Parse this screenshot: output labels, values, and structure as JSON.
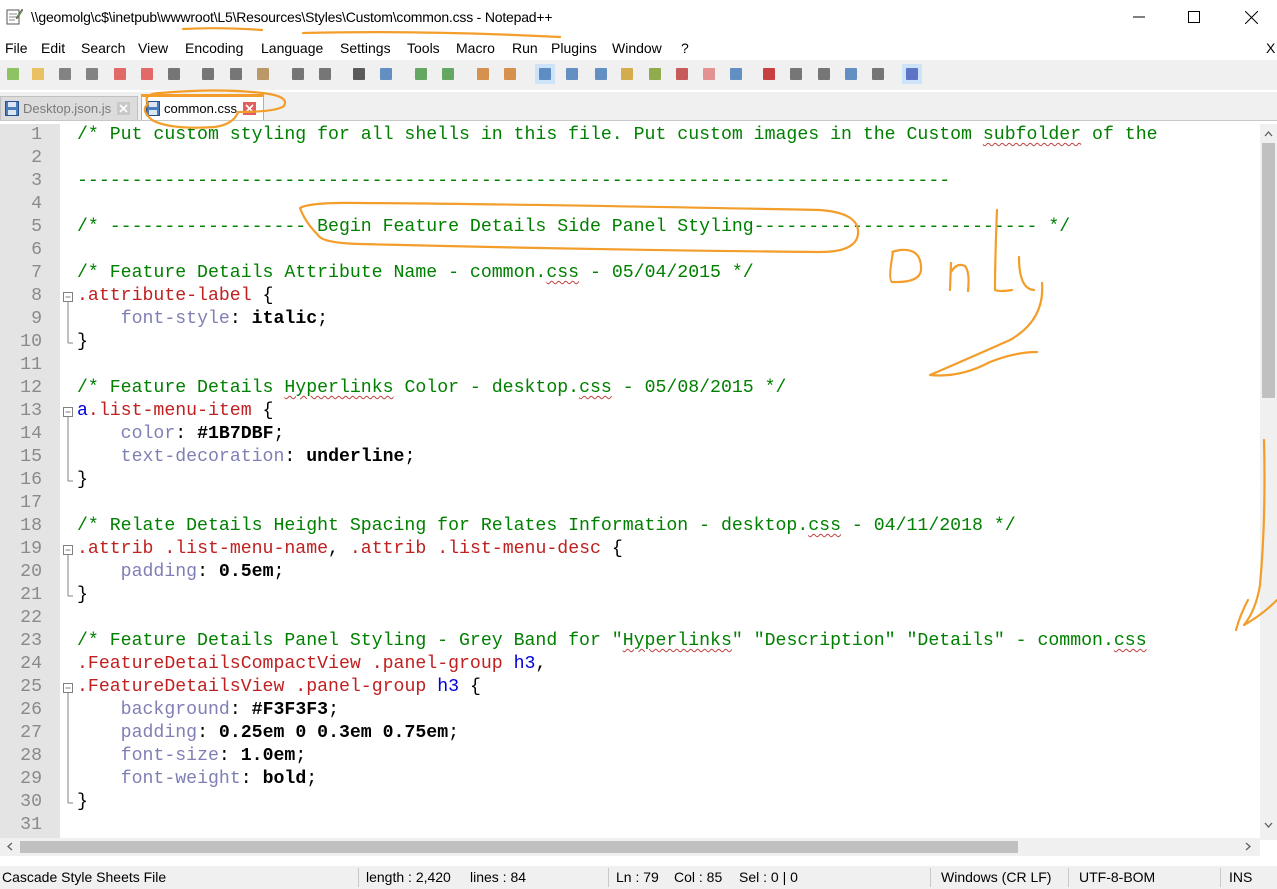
{
  "window": {
    "title": "\\\\geomolg\\c$\\inetpub\\wwwroot\\L5\\Resources\\Styles\\Custom\\common.css - Notepad++",
    "minimize_glyph": "—",
    "close_glyph": "✕"
  },
  "menu": {
    "items": [
      "File",
      "Edit",
      "Search",
      "View",
      "Encoding",
      "Language",
      "Settings",
      "Tools",
      "Macro",
      "Run",
      "Plugins",
      "Window",
      "?"
    ],
    "close_doc": "X"
  },
  "toolbar": {
    "icons": [
      "new-file-icon",
      "open-file-icon",
      "save-icon",
      "save-all-icon",
      "close-icon",
      "close-all-icon",
      "print-icon",
      "cut-icon",
      "copy-icon",
      "paste-icon",
      "undo-icon",
      "redo-icon",
      "find-icon",
      "replace-icon",
      "zoom-in-icon",
      "zoom-out-icon",
      "sync-vertical-icon",
      "sync-horizontal-icon",
      "word-wrap-icon",
      "show-all-chars-icon",
      "indent-guide-icon",
      "doc-map-icon",
      "function-list-icon",
      "folder-workspace-icon",
      "monitor-icon",
      "eye-icon",
      "record-macro-icon",
      "stop-macro-icon",
      "play-macro-icon",
      "run-macro-multiple-icon",
      "save-macro-icon",
      "spell-check-icon"
    ]
  },
  "tabs": [
    {
      "label": "Desktop.json.js",
      "active": false
    },
    {
      "label": "common.css",
      "active": true
    }
  ],
  "editor": {
    "lines": [
      {
        "n": "1",
        "segs": [
          {
            "t": "/* Put custom styling for all shells in this file. Put custom images in the Custom ",
            "c": "c"
          },
          {
            "t": "subfolder",
            "c": "c sq"
          },
          {
            "t": " of the",
            "c": "c"
          }
        ]
      },
      {
        "n": "2",
        "segs": []
      },
      {
        "n": "3",
        "segs": [
          {
            "t": "--------------------------------------------------------------------------------",
            "c": "c"
          }
        ]
      },
      {
        "n": "4",
        "segs": []
      },
      {
        "n": "5",
        "segs": [
          {
            "t": "/* ------------------ Begin Feature Details Side Panel Styling-------------------------- */",
            "c": "c"
          }
        ]
      },
      {
        "n": "6",
        "segs": []
      },
      {
        "n": "7",
        "segs": [
          {
            "t": "/* Feature Details Attribute Name - common.",
            "c": "c"
          },
          {
            "t": "css",
            "c": "c sq"
          },
          {
            "t": " - 05/04/2015 */",
            "c": "c"
          }
        ]
      },
      {
        "n": "8",
        "fold": "start",
        "segs": [
          {
            "t": ".attribute-label",
            "c": "s"
          },
          {
            "t": " {",
            "c": "o"
          }
        ]
      },
      {
        "n": "9",
        "fold": "mid",
        "segs": [
          {
            "t": "    ",
            "c": "o"
          },
          {
            "t": "font-style",
            "c": "p"
          },
          {
            "t": ": ",
            "c": "o"
          },
          {
            "t": "italic",
            "c": "v"
          },
          {
            "t": ";",
            "c": "o"
          }
        ]
      },
      {
        "n": "10",
        "fold": "end",
        "segs": [
          {
            "t": "}",
            "c": "o"
          }
        ]
      },
      {
        "n": "11",
        "segs": []
      },
      {
        "n": "12",
        "segs": [
          {
            "t": "/* Feature Details ",
            "c": "c"
          },
          {
            "t": "Hyperlinks",
            "c": "c sq"
          },
          {
            "t": " Color - desktop.",
            "c": "c"
          },
          {
            "t": "css",
            "c": "c sq"
          },
          {
            "t": " - 05/08/2015 */",
            "c": "c"
          }
        ]
      },
      {
        "n": "13",
        "fold": "start",
        "segs": [
          {
            "t": "a",
            "c": "k"
          },
          {
            "t": ".list-menu-item",
            "c": "s"
          },
          {
            "t": " {",
            "c": "o"
          }
        ]
      },
      {
        "n": "14",
        "fold": "mid",
        "segs": [
          {
            "t": "    ",
            "c": "o"
          },
          {
            "t": "color",
            "c": "p"
          },
          {
            "t": ": ",
            "c": "o"
          },
          {
            "t": "#1B7DBF",
            "c": "v"
          },
          {
            "t": ";",
            "c": "o"
          }
        ]
      },
      {
        "n": "15",
        "fold": "mid",
        "segs": [
          {
            "t": "    ",
            "c": "o"
          },
          {
            "t": "text-decoration",
            "c": "p"
          },
          {
            "t": ": ",
            "c": "o"
          },
          {
            "t": "underline",
            "c": "v"
          },
          {
            "t": ";",
            "c": "o"
          }
        ]
      },
      {
        "n": "16",
        "fold": "end",
        "segs": [
          {
            "t": "}",
            "c": "o"
          }
        ]
      },
      {
        "n": "17",
        "segs": []
      },
      {
        "n": "18",
        "segs": [
          {
            "t": "/* Relate Details Height Spacing for Relates Information - desktop.",
            "c": "c"
          },
          {
            "t": "css",
            "c": "c sq"
          },
          {
            "t": " - 04/11/2018 */",
            "c": "c"
          }
        ]
      },
      {
        "n": "19",
        "fold": "start",
        "segs": [
          {
            "t": ".attrib",
            "c": "s"
          },
          {
            "t": " ",
            "c": "o"
          },
          {
            "t": ".list-menu-name",
            "c": "s"
          },
          {
            "t": ", ",
            "c": "o"
          },
          {
            "t": ".attrib",
            "c": "s"
          },
          {
            "t": " ",
            "c": "o"
          },
          {
            "t": ".list-menu-desc",
            "c": "s"
          },
          {
            "t": " {",
            "c": "o"
          }
        ]
      },
      {
        "n": "20",
        "fold": "mid",
        "segs": [
          {
            "t": "    ",
            "c": "o"
          },
          {
            "t": "padding",
            "c": "p"
          },
          {
            "t": ": ",
            "c": "o"
          },
          {
            "t": "0.5em",
            "c": "v"
          },
          {
            "t": ";",
            "c": "o"
          }
        ]
      },
      {
        "n": "21",
        "fold": "end",
        "segs": [
          {
            "t": "}",
            "c": "o"
          }
        ]
      },
      {
        "n": "22",
        "segs": []
      },
      {
        "n": "23",
        "segs": [
          {
            "t": "/* Feature Details Panel Styling - Grey Band for \"",
            "c": "c"
          },
          {
            "t": "Hyperlinks",
            "c": "c sq"
          },
          {
            "t": "\" \"Description\" \"Details\" - common.",
            "c": "c"
          },
          {
            "t": "css",
            "c": "c sq"
          }
        ]
      },
      {
        "n": "24",
        "segs": [
          {
            "t": ".FeatureDetailsCompactView",
            "c": "s"
          },
          {
            "t": " ",
            "c": "o"
          },
          {
            "t": ".panel-group",
            "c": "s"
          },
          {
            "t": " ",
            "c": "o"
          },
          {
            "t": "h3",
            "c": "k"
          },
          {
            "t": ",",
            "c": "o"
          }
        ]
      },
      {
        "n": "25",
        "fold": "start",
        "segs": [
          {
            "t": ".FeatureDetailsView",
            "c": "s"
          },
          {
            "t": " ",
            "c": "o"
          },
          {
            "t": ".panel-group",
            "c": "s"
          },
          {
            "t": " ",
            "c": "o"
          },
          {
            "t": "h3",
            "c": "k"
          },
          {
            "t": " {",
            "c": "o"
          }
        ]
      },
      {
        "n": "26",
        "fold": "mid",
        "segs": [
          {
            "t": "    ",
            "c": "o"
          },
          {
            "t": "background",
            "c": "p"
          },
          {
            "t": ": ",
            "c": "o"
          },
          {
            "t": "#F3F3F3",
            "c": "v"
          },
          {
            "t": ";",
            "c": "o"
          }
        ]
      },
      {
        "n": "27",
        "fold": "mid",
        "segs": [
          {
            "t": "    ",
            "c": "o"
          },
          {
            "t": "padding",
            "c": "p"
          },
          {
            "t": ": ",
            "c": "o"
          },
          {
            "t": "0.25em 0 0.3em 0.75em",
            "c": "v"
          },
          {
            "t": ";",
            "c": "o"
          }
        ]
      },
      {
        "n": "28",
        "fold": "mid",
        "segs": [
          {
            "t": "    ",
            "c": "o"
          },
          {
            "t": "font-size",
            "c": "p"
          },
          {
            "t": ": ",
            "c": "o"
          },
          {
            "t": "1.0em",
            "c": "v"
          },
          {
            "t": ";",
            "c": "o"
          }
        ]
      },
      {
        "n": "29",
        "fold": "mid",
        "segs": [
          {
            "t": "    ",
            "c": "o"
          },
          {
            "t": "font-weight",
            "c": "p"
          },
          {
            "t": ": ",
            "c": "o"
          },
          {
            "t": "bold",
            "c": "v"
          },
          {
            "t": ";",
            "c": "o"
          }
        ]
      },
      {
        "n": "30",
        "fold": "end",
        "segs": [
          {
            "t": "}",
            "c": "o"
          }
        ]
      },
      {
        "n": "31",
        "segs": []
      }
    ]
  },
  "annotation": {
    "handwritten_text": "Only 2"
  },
  "status": {
    "file_type": "Cascade Style Sheets File",
    "length": "length : 2,420",
    "lines": "lines : 84",
    "ln": "Ln : 79",
    "col": "Col : 85",
    "sel": "Sel : 0 | 0",
    "eol": "Windows (CR LF)",
    "encoding": "UTF-8-BOM",
    "mode": "INS"
  },
  "colors": {
    "comment": "#008000",
    "selector": "#c02020",
    "tag": "#0000d8",
    "property": "#7f7fb5",
    "annotation": "#f39d2a"
  }
}
